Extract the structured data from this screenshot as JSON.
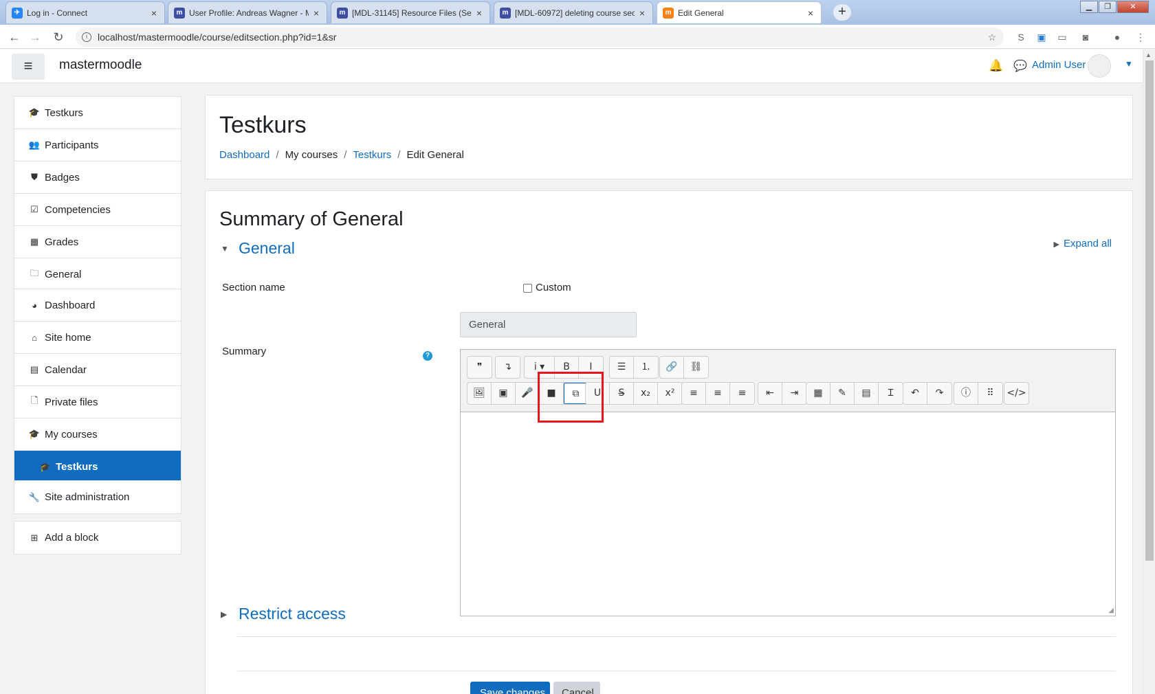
{
  "browser": {
    "tabs": [
      {
        "title": "Log in - Connect",
        "icon": "jira-icon",
        "color": "#2684ff",
        "glyph": "✈"
      },
      {
        "title": "User Profile: Andreas Wagner - M",
        "icon": "moodle-tracker-icon",
        "color": "#3e4fa3",
        "glyph": "m"
      },
      {
        "title": "[MDL-31145] Resource Files (Sect",
        "icon": "moodle-tracker-icon",
        "color": "#3e4fa3",
        "glyph": "m"
      },
      {
        "title": "[MDL-60972] deleting course sec",
        "icon": "moodle-tracker-icon",
        "color": "#3e4fa3",
        "glyph": "m"
      },
      {
        "title": "Edit General",
        "icon": "moodle-icon",
        "color": "#f98012",
        "glyph": "m"
      }
    ],
    "url": "localhost/mastermoodle/course/editsection.php?id=1&sr"
  },
  "navbar": {
    "sitename": "mastermoodle",
    "username": "Admin User"
  },
  "drawer": {
    "course_items": [
      {
        "label": "Testkurs",
        "icon": "graduation-cap-icon",
        "glyph": "🎓"
      },
      {
        "label": "Participants",
        "icon": "users-icon",
        "glyph": "👥"
      },
      {
        "label": "Badges",
        "icon": "shield-icon",
        "glyph": "⛊"
      },
      {
        "label": "Competencies",
        "icon": "check-square-icon",
        "glyph": "☑"
      },
      {
        "label": "Grades",
        "icon": "table-icon",
        "glyph": "▦"
      },
      {
        "label": "General",
        "icon": "folder-icon",
        "glyph": "🗀"
      }
    ],
    "site_items": [
      {
        "label": "Dashboard",
        "icon": "dashboard-icon",
        "glyph": "◕"
      },
      {
        "label": "Site home",
        "icon": "home-icon",
        "glyph": "⌂"
      },
      {
        "label": "Calendar",
        "icon": "calendar-icon",
        "glyph": "▤"
      },
      {
        "label": "Private files",
        "icon": "file-icon",
        "glyph": "🗋"
      },
      {
        "label": "My courses",
        "icon": "graduation-cap-icon",
        "glyph": "🎓"
      },
      {
        "label": "Testkurs",
        "icon": "graduation-cap-icon",
        "glyph": "🎓"
      }
    ],
    "admin_item": {
      "label": "Site administration",
      "icon": "wrench-icon",
      "glyph": "🔧"
    },
    "addblock_item": {
      "label": "Add a block",
      "icon": "plus-square-icon",
      "glyph": "⊞"
    }
  },
  "header": {
    "course_title": "Testkurs",
    "breadcrumb": [
      "Dashboard",
      "My courses",
      "Testkurs",
      "Edit General"
    ]
  },
  "main": {
    "page_title": "Summary of General",
    "expand_all": "Expand all",
    "general_section": "General",
    "section_name_label": "Section name",
    "custom_label": "Custom",
    "section_name_value": "General",
    "summary_label": "Summary",
    "restrict_access": "Restrict access",
    "save_label": "Save changes",
    "cancel_label": "Cancel"
  },
  "editor": {
    "row1": [
      [
        {
          "name": "blockquote-icon",
          "g": "❞"
        }
      ],
      [
        {
          "name": "collapse-toolbar-icon",
          "g": "↴",
          "sel": false
        }
      ],
      [
        {
          "name": "paragraph-styles-icon",
          "g": "i ▾"
        },
        {
          "name": "bold-icon",
          "g": "B"
        },
        {
          "name": "italic-icon",
          "g": "I"
        }
      ],
      [
        {
          "name": "unordered-list-icon",
          "g": "☰"
        },
        {
          "name": "ordered-list-icon",
          "g": "⒈"
        }
      ],
      [
        {
          "name": "link-icon",
          "g": "🔗"
        },
        {
          "name": "unlink-icon",
          "g": "⛓"
        }
      ]
    ],
    "row2": [
      [
        {
          "name": "insert-image-icon",
          "g": "🖼"
        },
        {
          "name": "insert-media-icon",
          "g": "▣"
        },
        {
          "name": "record-audio-icon",
          "g": "🎤"
        },
        {
          "name": "record-video-icon",
          "g": "■"
        },
        {
          "name": "manage-files-icon",
          "g": "⧉",
          "sel": true
        }
      ],
      [
        {
          "name": "underline-icon",
          "g": "U"
        },
        {
          "name": "strikethrough-icon",
          "g": "S̶"
        },
        {
          "name": "subscript-icon",
          "g": "x₂"
        },
        {
          "name": "superscript-icon",
          "g": "x²"
        }
      ],
      [
        {
          "name": "align-left-icon",
          "g": "≡"
        },
        {
          "name": "align-center-icon",
          "g": "≡"
        },
        {
          "name": "align-right-icon",
          "g": "≡"
        }
      ],
      [
        {
          "name": "outdent-icon",
          "g": "⇤"
        },
        {
          "name": "indent-icon",
          "g": "⇥"
        }
      ],
      [
        {
          "name": "equation-icon",
          "g": "▦"
        },
        {
          "name": "special-char-icon",
          "g": "✎"
        },
        {
          "name": "table-icon",
          "g": "▤"
        },
        {
          "name": "clear-formatting-icon",
          "g": "Ɪ"
        }
      ],
      [
        {
          "name": "undo-icon",
          "g": "↶"
        },
        {
          "name": "redo-icon",
          "g": "↷"
        }
      ],
      [
        {
          "name": "accessibility-checker-icon",
          "g": "ⓘ"
        },
        {
          "name": "screenreader-helper-icon",
          "g": "⠿"
        }
      ],
      [
        {
          "name": "html-source-icon",
          "g": "</>"
        }
      ]
    ]
  }
}
